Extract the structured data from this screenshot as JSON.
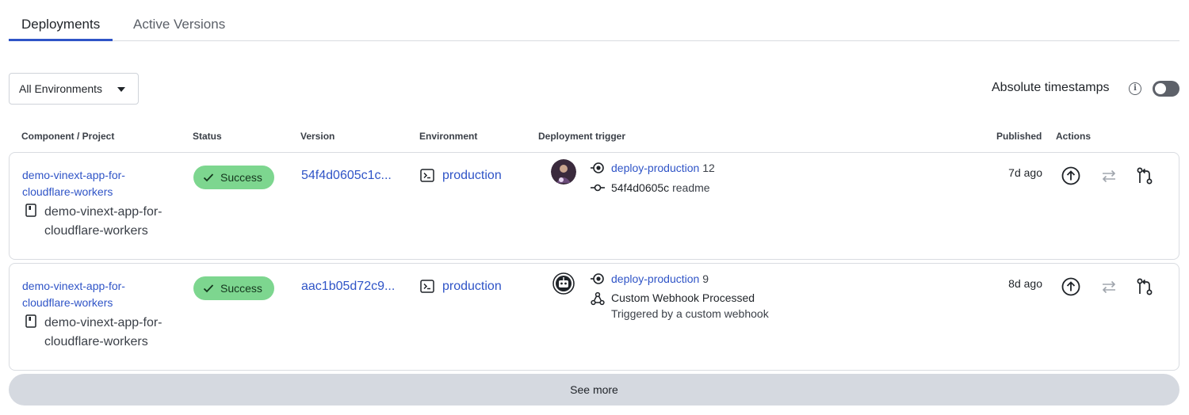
{
  "tabs": [
    {
      "label": "Deployments",
      "active": true
    },
    {
      "label": "Active Versions",
      "active": false
    }
  ],
  "filter": {
    "environment_selected": "All Environments"
  },
  "timestamps": {
    "label": "Absolute timestamps",
    "enabled": false
  },
  "table": {
    "headers": {
      "component": "Component / Project",
      "status": "Status",
      "version": "Version",
      "environment": "Environment",
      "trigger": "Deployment trigger",
      "published": "Published",
      "actions": "Actions"
    },
    "rows": [
      {
        "component_link": "demo-vinext-app-for-cloudflare-workers",
        "repo_name": "demo-vinext-app-for-cloudflare-workers",
        "status": "Success",
        "version": "54f4d0605c1c...",
        "environment": "production",
        "trigger_name": "deploy-production",
        "trigger_number": "12",
        "commit_sha": "54f4d0605c",
        "commit_message": "readme",
        "published": "7d ago"
      },
      {
        "component_link": "demo-vinext-app-for-cloudflare-workers",
        "repo_name": "demo-vinext-app-for-cloudflare-workers",
        "status": "Success",
        "version": "aac1b05d72c9...",
        "environment": "production",
        "trigger_name": "deploy-production",
        "trigger_number": "9",
        "webhook_title": "Custom Webhook Processed",
        "webhook_subtitle": "Triggered by a custom webhook",
        "published": "8d ago"
      }
    ]
  },
  "see_more_label": "See more",
  "colors": {
    "link": "#2f54c7",
    "success_badge": "#7dd68f",
    "toggle_off": "#5d6169",
    "see_more_bg": "#d5d9e0"
  }
}
